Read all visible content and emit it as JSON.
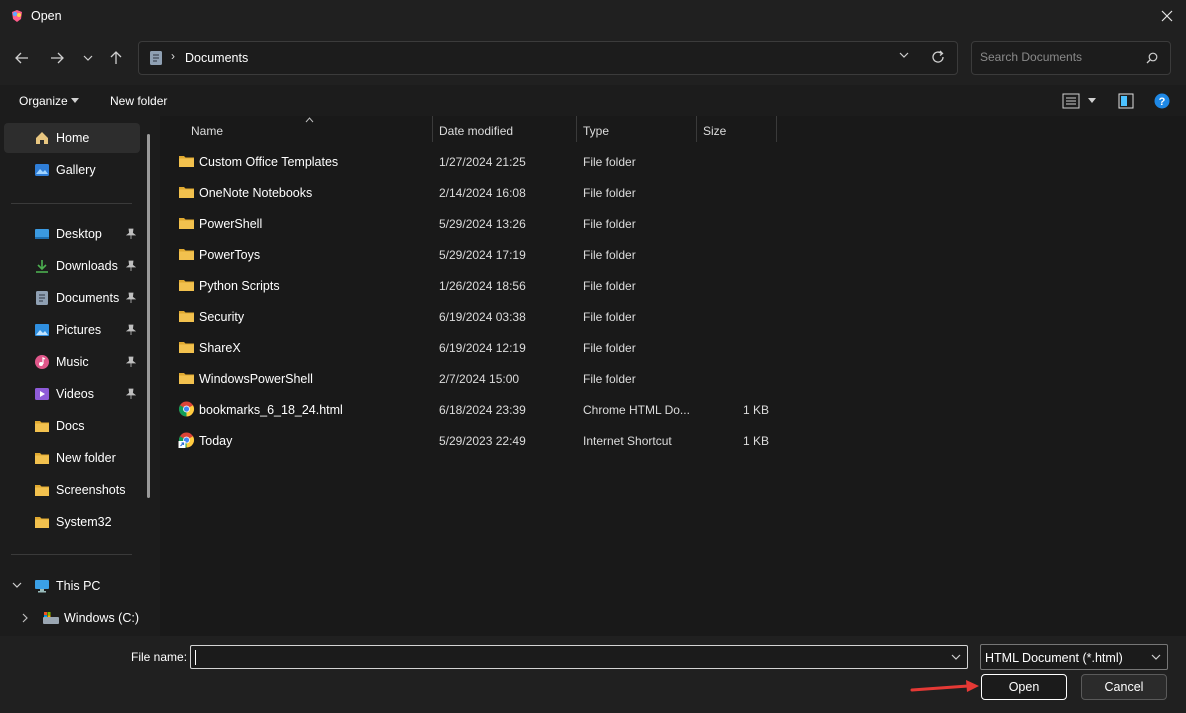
{
  "window": {
    "title": "Open",
    "app_icon": "app-logo-icon",
    "close_icon": "close-icon"
  },
  "nav": {
    "back_icon": "back-arrow-icon",
    "forward_icon": "forward-arrow-icon",
    "recent_icon": "chevron-down-icon",
    "up_icon": "up-arrow-icon"
  },
  "address": {
    "path": "Documents",
    "separator": "›"
  },
  "search": {
    "placeholder": "Search Documents"
  },
  "toolbar": {
    "organize_label": "Organize",
    "new_folder_label": "New folder"
  },
  "sidebar": {
    "items": [
      {
        "label": "Home",
        "icon": "home-icon",
        "pinned": false
      },
      {
        "label": "Gallery",
        "icon": "gallery-icon",
        "pinned": false
      },
      {
        "label": "Desktop",
        "icon": "desktop-icon",
        "pinned": true
      },
      {
        "label": "Downloads",
        "icon": "download-icon",
        "pinned": true
      },
      {
        "label": "Documents",
        "icon": "documents-icon",
        "pinned": true
      },
      {
        "label": "Pictures",
        "icon": "pictures-icon",
        "pinned": true
      },
      {
        "label": "Music",
        "icon": "music-icon",
        "pinned": true
      },
      {
        "label": "Videos",
        "icon": "videos-icon",
        "pinned": true
      },
      {
        "label": "Docs",
        "icon": "folder-icon",
        "pinned": false
      },
      {
        "label": "New folder",
        "icon": "folder-icon",
        "pinned": false
      },
      {
        "label": "Screenshots",
        "icon": "folder-icon",
        "pinned": false
      },
      {
        "label": "System32",
        "icon": "folder-icon",
        "pinned": false
      },
      {
        "label": "This PC",
        "icon": "computer-icon",
        "pinned": false
      },
      {
        "label": "Windows (C:)",
        "icon": "drive-icon",
        "pinned": false
      }
    ]
  },
  "columns": {
    "name": "Name",
    "date": "Date modified",
    "type": "Type",
    "size": "Size"
  },
  "files": [
    {
      "name": "Custom Office Templates",
      "date": "1/27/2024 21:25",
      "type": "File folder",
      "size": "",
      "icon": "folder-icon"
    },
    {
      "name": "OneNote Notebooks",
      "date": "2/14/2024 16:08",
      "type": "File folder",
      "size": "",
      "icon": "folder-icon"
    },
    {
      "name": "PowerShell",
      "date": "5/29/2024 13:26",
      "type": "File folder",
      "size": "",
      "icon": "folder-icon"
    },
    {
      "name": "PowerToys",
      "date": "5/29/2024 17:19",
      "type": "File folder",
      "size": "",
      "icon": "folder-icon"
    },
    {
      "name": "Python Scripts",
      "date": "1/26/2024 18:56",
      "type": "File folder",
      "size": "",
      "icon": "folder-icon"
    },
    {
      "name": "Security",
      "date": "6/19/2024 03:38",
      "type": "File folder",
      "size": "",
      "icon": "folder-icon"
    },
    {
      "name": "ShareX",
      "date": "6/19/2024 12:19",
      "type": "File folder",
      "size": "",
      "icon": "folder-icon"
    },
    {
      "name": "WindowsPowerShell",
      "date": "2/7/2024 15:00",
      "type": "File folder",
      "size": "",
      "icon": "folder-icon"
    },
    {
      "name": "bookmarks_6_18_24.html",
      "date": "6/18/2024 23:39",
      "type": "Chrome HTML Do...",
      "size": "1 KB",
      "icon": "chrome-icon"
    },
    {
      "name": "Today",
      "date": "5/29/2023 22:49",
      "type": "Internet Shortcut",
      "size": "1 KB",
      "icon": "chrome-shortcut-icon"
    }
  ],
  "bottom": {
    "file_name_label": "File name:",
    "file_name_value": "",
    "filter_value": "HTML Document (*.html)",
    "open_label": "Open",
    "cancel_label": "Cancel"
  },
  "colors": {
    "folder": "#F2C14E",
    "accent": "#4CC2FF",
    "annotation_arrow": "#E53935"
  }
}
